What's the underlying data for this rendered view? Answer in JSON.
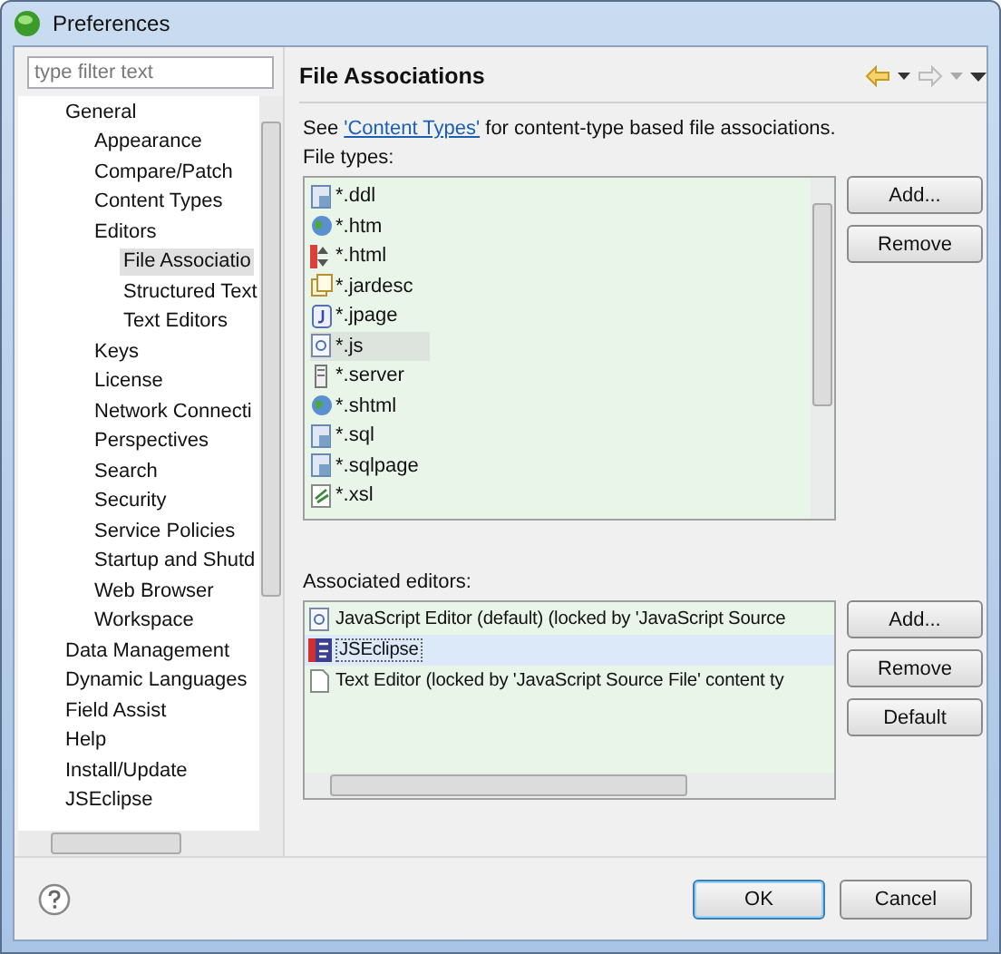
{
  "window": {
    "title": "Preferences"
  },
  "filter": {
    "placeholder": "type filter text"
  },
  "tree": [
    {
      "label": "General",
      "selected": false,
      "children": [
        {
          "label": "Appearance",
          "selected": false
        },
        {
          "label": "Compare/Patch",
          "selected": false
        },
        {
          "label": "Content Types",
          "selected": false
        },
        {
          "label": "Editors",
          "selected": false,
          "children": [
            {
              "label": "File Associatio",
              "selected": true
            },
            {
              "label": "Structured Text",
              "selected": false
            },
            {
              "label": "Text Editors",
              "selected": false
            }
          ]
        },
        {
          "label": "Keys",
          "selected": false
        },
        {
          "label": "License",
          "selected": false
        },
        {
          "label": "Network Connecti",
          "selected": false
        },
        {
          "label": "Perspectives",
          "selected": false
        },
        {
          "label": "Search",
          "selected": false
        },
        {
          "label": "Security",
          "selected": false
        },
        {
          "label": "Service Policies",
          "selected": false
        },
        {
          "label": "Startup and Shutd",
          "selected": false
        },
        {
          "label": "Web Browser",
          "selected": false
        },
        {
          "label": "Workspace",
          "selected": false
        }
      ]
    },
    {
      "label": "Data Management",
      "selected": false
    },
    {
      "label": "Dynamic Languages",
      "selected": false
    },
    {
      "label": "Field Assist",
      "selected": false
    },
    {
      "label": "Help",
      "selected": false
    },
    {
      "label": "Install/Update",
      "selected": false
    },
    {
      "label": "JSEclipse",
      "selected": false
    }
  ],
  "page": {
    "title": "File Associations",
    "description_before": "See ",
    "link": "'Content Types'",
    "description_after": " for content-type based file associations."
  },
  "file_types": {
    "label": "File types:",
    "items": [
      {
        "label": "*.ddl",
        "kind": "page",
        "selected": false
      },
      {
        "label": "*.htm",
        "kind": "globe",
        "selected": false
      },
      {
        "label": "*.html",
        "kind": "html",
        "selected": false
      },
      {
        "label": "*.jardesc",
        "kind": "jar",
        "selected": false
      },
      {
        "label": "*.jpage",
        "kind": "j",
        "selected": false
      },
      {
        "label": "*.js",
        "kind": "js",
        "selected": true
      },
      {
        "label": "*.server",
        "kind": "server",
        "selected": false
      },
      {
        "label": "*.shtml",
        "kind": "globe",
        "selected": false
      },
      {
        "label": "*.sql",
        "kind": "page",
        "selected": false
      },
      {
        "label": "*.sqlpage",
        "kind": "page",
        "selected": false
      },
      {
        "label": "*.xsl",
        "kind": "xsl",
        "selected": false
      }
    ],
    "buttons": [
      "Add...",
      "Remove"
    ]
  },
  "editors": {
    "label": "Associated editors:",
    "items": [
      {
        "label": "JavaScript Editor (default) (locked by 'JavaScript Source",
        "kind": "js",
        "selected": false
      },
      {
        "label": "JSEclipse",
        "kind": "jse",
        "selected": true
      },
      {
        "label": "Text Editor (locked by 'JavaScript Source File' content ty",
        "kind": "text",
        "selected": false
      }
    ],
    "buttons": [
      "Add...",
      "Remove",
      "Default"
    ]
  },
  "footer": {
    "buttons": [
      "OK",
      "Cancel"
    ]
  }
}
